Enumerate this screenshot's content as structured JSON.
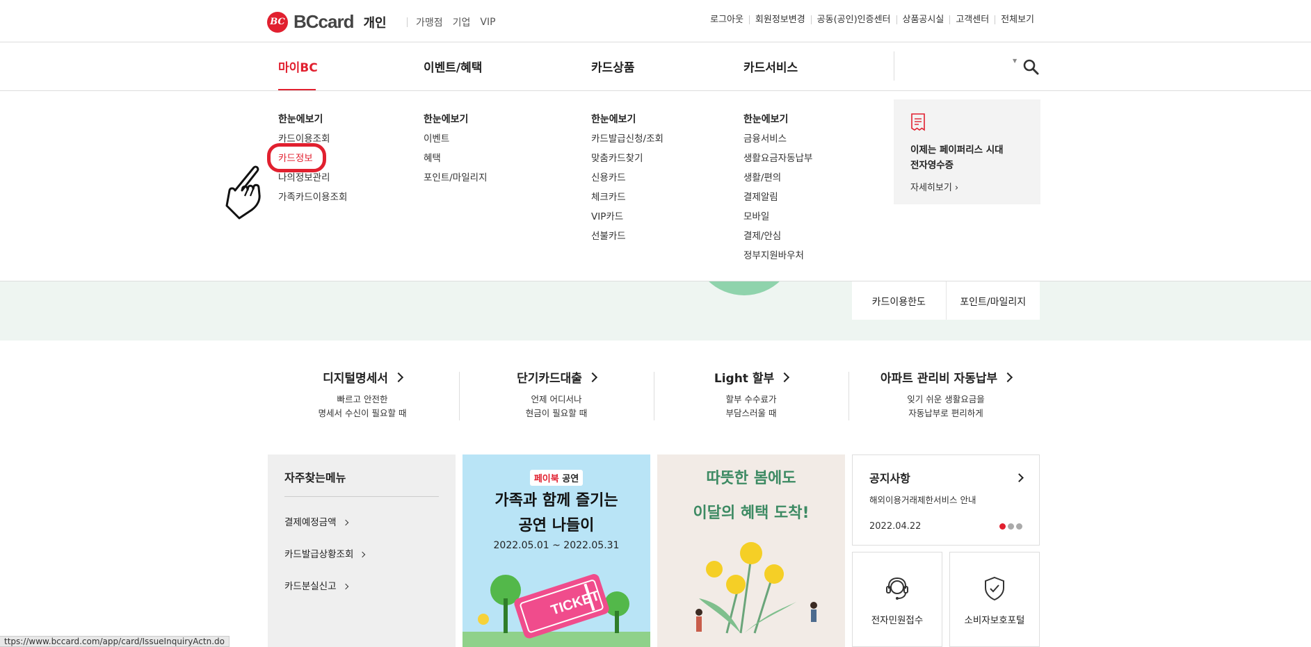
{
  "header": {
    "logo_text": "BCcard",
    "logo_mark": "BC",
    "section": "개인",
    "sub_links": [
      "가맹점",
      "기업",
      "VIP"
    ],
    "util_links": [
      "로그아웃",
      "회원정보변경",
      "공동(공인)인증센터",
      "상품공시실",
      "고객센터",
      "전체보기"
    ]
  },
  "gnb": {
    "items": [
      "마이BC",
      "이벤트/혜택",
      "카드상품",
      "카드서비스"
    ],
    "active": "마이BC"
  },
  "mega_menu": {
    "columns": [
      {
        "head": "한눈에보기",
        "items": [
          "카드이용조회",
          "카드정보",
          "나의정보관리",
          "가족카드이용조회"
        ]
      },
      {
        "head": "한눈에보기",
        "items": [
          "이벤트",
          "혜택",
          "포인트/마일리지"
        ]
      },
      {
        "head": "한눈에보기",
        "items": [
          "카드발급신청/조회",
          "맞춤카드찾기",
          "신용카드",
          "체크카드",
          "VIP카드",
          "선불카드"
        ]
      },
      {
        "head": "한눈에보기",
        "items": [
          "금융서비스",
          "생활요금자동납부",
          "생활/편의",
          "결제알림",
          "모바일",
          "결제/안심",
          "정부지원바우처"
        ]
      }
    ],
    "promo": {
      "line1": "이제는 페이퍼리스 시대",
      "line2": "전자영수증",
      "more": "자세히보기 ›",
      "icon": "receipt-icon"
    }
  },
  "hero_box": [
    "카드이용한도",
    "포인트/마일리지"
  ],
  "quick_banners": [
    {
      "title": "디지털명세서",
      "desc1": "빠르고 안전한",
      "desc2": "명세서 수신이 필요할 때"
    },
    {
      "title": "단기카드대출",
      "desc1": "언제 어디서나",
      "desc2": "현금이 필요할 때"
    },
    {
      "title": "Light 할부",
      "desc1": "할부 수수료가",
      "desc2": "부담스러울 때"
    },
    {
      "title": "아파트 관리비 자동납부",
      "desc1": "잊기 쉬운 생활요금을",
      "desc2": "자동납부로 편리하게"
    }
  ],
  "frequent_menu": {
    "title": "자주찾는메뉴",
    "items": [
      "결제예정금액",
      "카드발급상황조회",
      "카드분실신고"
    ]
  },
  "banner_paybook": {
    "tag_brand": "페이북",
    "tag_suffix": "공연",
    "line1": "가족과 함께 즐기는",
    "line2": "공연 나들이",
    "period": "2022.05.01 ~ 2022.05.31",
    "ticket": "TICKET"
  },
  "banner_spring": {
    "line1": "따뜻한 봄에도",
    "line2": "이달의 혜택 도착!"
  },
  "notice": {
    "title": "공지사항",
    "desc": "해외이용거래제한서비스 안내",
    "date": "2022.04.22"
  },
  "services": [
    "전자민원접수",
    "소비자보호포털"
  ],
  "status_url": "ttps://www.bccard.com/app/card/IssueInquiryActn.do",
  "colors": {
    "brand": "#e1202f",
    "hero_bg": "#eef5f1",
    "paybook_bg": "#b9e4f6",
    "spring_bg": "#f2ebe6"
  }
}
